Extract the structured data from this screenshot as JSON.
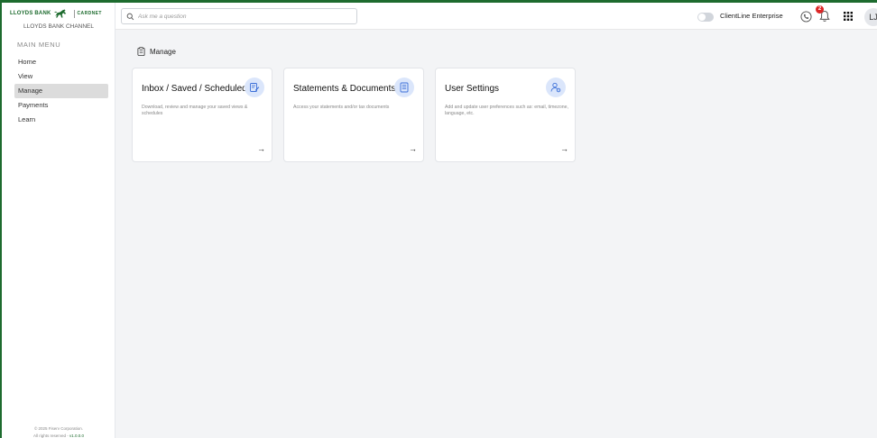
{
  "sidebar": {
    "logo_text": "LLOYDS BANK",
    "cardnet": "CARDNET",
    "channel_name": "LLOYDS BANK CHANNEL",
    "menu_title": "MAIN MENU",
    "items": [
      {
        "label": "Home"
      },
      {
        "label": "View"
      },
      {
        "label": "Manage",
        "active": true
      },
      {
        "label": "Payments"
      },
      {
        "label": "Learn"
      }
    ],
    "footer_line1": "© 2025 Fiserv Corporation.",
    "footer_line2": "All rights reserved -",
    "version": "v1.0.0.0"
  },
  "header": {
    "search_placeholder": "Ask me a question",
    "enterprise_label": "ClientLine Enterprise",
    "notification_count": "2",
    "avatar_initials": "LJ"
  },
  "page": {
    "title": "Manage"
  },
  "cards": [
    {
      "title": "Inbox / Saved / Scheduled",
      "description": "Download, review and manage your saved views & schedules",
      "icon": "edit-document-icon",
      "arrow": "→"
    },
    {
      "title": "Statements & Documents",
      "description": "Access your statements and/or tax documents",
      "icon": "document-icon",
      "arrow": "→"
    },
    {
      "title": "User Settings",
      "description": "Add and update user preferences such as: email, timezone, language, etc.",
      "icon": "user-settings-icon",
      "arrow": "→"
    }
  ],
  "colors": {
    "brand": "#1d6b2e",
    "accent_bg": "#dbe6fb",
    "accent_icon": "#3b6fd8",
    "badge": "#dc2626"
  }
}
